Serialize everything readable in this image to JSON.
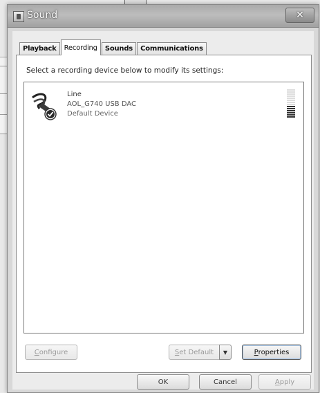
{
  "window": {
    "title": "Sound",
    "close_glyph": "✕"
  },
  "tabs": [
    {
      "label": "Playback",
      "active": false
    },
    {
      "label": "Recording",
      "active": true
    },
    {
      "label": "Sounds",
      "active": false
    },
    {
      "label": "Communications",
      "active": false
    }
  ],
  "recording": {
    "instruction": "Select a recording device below to modify its settings:",
    "devices": [
      {
        "name": "Line",
        "description": "AOL_G740 USB DAC",
        "status": "Default Device",
        "icon": "audio-cable-icon",
        "level_fraction": 0.45
      }
    ]
  },
  "buttons": {
    "configure": {
      "label": "Configure",
      "mnemonic": "C",
      "rest": "onfigure",
      "enabled": false
    },
    "set_default": {
      "label": "Set Default",
      "mnemonic": "S",
      "rest": "et Default",
      "enabled": false
    },
    "properties": {
      "label": "Properties",
      "mnemonic": "P",
      "rest": "roperties",
      "enabled": true
    },
    "ok": {
      "label": "OK"
    },
    "cancel": {
      "label": "Cancel"
    },
    "apply": {
      "label": "Apply",
      "mnemonic": "A",
      "rest": "pply",
      "enabled": false
    }
  }
}
